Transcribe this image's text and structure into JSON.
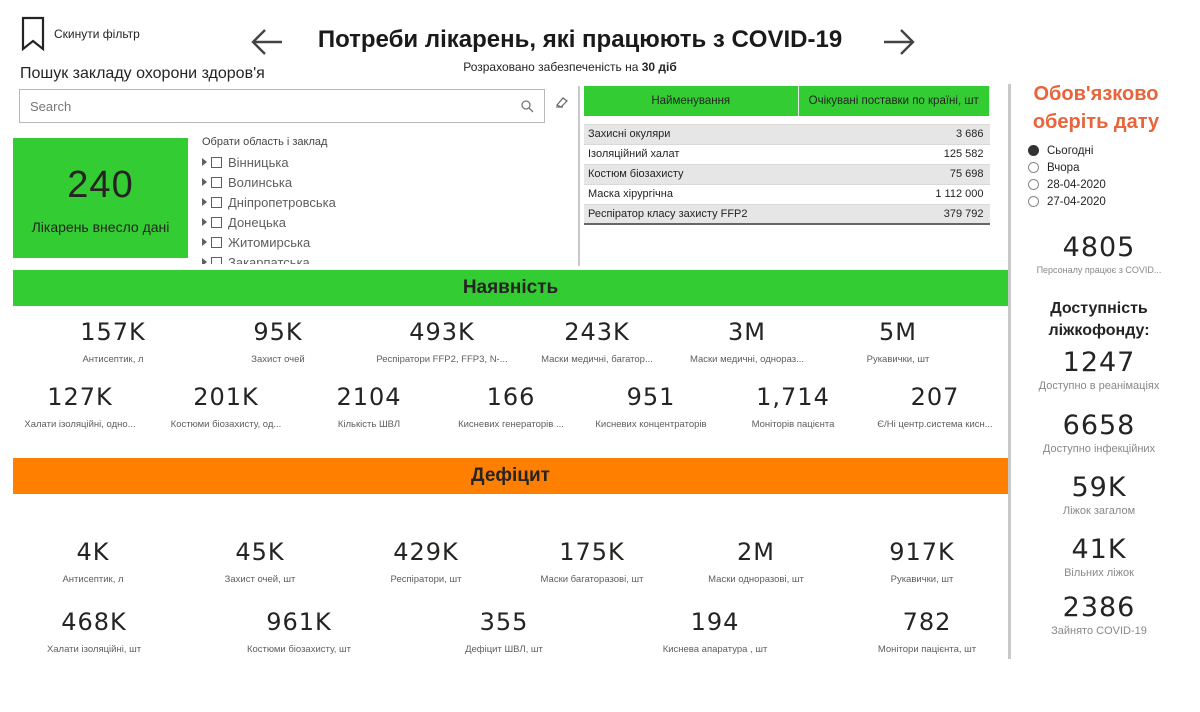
{
  "header": {
    "reset_filter": "Скинути фільтр",
    "title": "Потреби лікарень, які працюють з COVID-19",
    "subtitle_prefix": "Розраховано забезпеченість на",
    "subtitle_days": "30 діб"
  },
  "search": {
    "label": "Пошук закладу охорони здоров'я",
    "placeholder": "Search"
  },
  "hospitals_card": {
    "value": "240",
    "label": "Лікарень внесло дані"
  },
  "region_slicer": {
    "header": "Обрати область і заклад",
    "items": [
      "Вінницька",
      "Волинська",
      "Дніпропетровська",
      "Донецька",
      "Житомирська",
      "Закарпатська"
    ]
  },
  "supply_table": {
    "columns": [
      "Найменування",
      "Очікувані поставки по країні, шт"
    ],
    "rows": [
      [
        "Захисні окуляри",
        "3 686"
      ],
      [
        "Ізоляційний халат",
        "125 582"
      ],
      [
        "Костюм біозахисту",
        "75 698"
      ],
      [
        "Маска хірургічна",
        "1 112 000"
      ],
      [
        "Респіратор класу захисту FFP2",
        "379 792"
      ]
    ]
  },
  "availability": {
    "title": "Наявність",
    "row1": [
      {
        "value": "157K",
        "label": "Антисептик, л"
      },
      {
        "value": "95K",
        "label": "Захист очей"
      },
      {
        "value": "493K",
        "label": "Респіратори FFP2, FFP3, N-..."
      },
      {
        "value": "243K",
        "label": "Маски медичні, багатор..."
      },
      {
        "value": "3M",
        "label": "Маски медичні, однораз..."
      },
      {
        "value": "5M",
        "label": "Рукавички, шт"
      }
    ],
    "row2": [
      {
        "value": "127K",
        "label": "Халати ізоляційні, одно..."
      },
      {
        "value": "201K",
        "label": "Костюми біозахисту, од..."
      },
      {
        "value": "2104",
        "label": "Кількість ШВЛ"
      },
      {
        "value": "166",
        "label": "Кисневих генераторів ..."
      },
      {
        "value": "951",
        "label": "Кисневих концентраторів"
      },
      {
        "value": "1,714",
        "label": "Моніторів пацієнта"
      },
      {
        "value": "207",
        "label": "Є/Ні центр.система кисн..."
      }
    ]
  },
  "deficit": {
    "title": "Дефіцит",
    "row1": [
      {
        "value": "4K",
        "label": "Антисептик, л"
      },
      {
        "value": "45K",
        "label": "Захист очей, шт"
      },
      {
        "value": "429K",
        "label": "Респіратори, шт"
      },
      {
        "value": "175K",
        "label": "Маски багаторазові, шт"
      },
      {
        "value": "2M",
        "label": "Маски одноразові, шт"
      },
      {
        "value": "917K",
        "label": "Рукавички, шт"
      }
    ],
    "row2": [
      {
        "value": "468K",
        "label": "Халати ізоляційні, шт"
      },
      {
        "value": "961K",
        "label": "Костюми біозахисту, шт"
      },
      {
        "value": "355",
        "label": "Дефіцит ШВЛ, шт"
      },
      {
        "value": "194",
        "label": "Киснева апаратура , шт"
      },
      {
        "value": "782",
        "label": "Монітори пацієнта, шт"
      }
    ]
  },
  "date_panel": {
    "title": "Обов'язково оберіть дату",
    "options": [
      "Сьогодні",
      "Вчора",
      "28-04-2020",
      "27-04-2020"
    ],
    "selected": "Сьогодні"
  },
  "staff": {
    "value": "4805",
    "label": "Персоналу працює з COVID..."
  },
  "beds": {
    "title": "Доступність ліжкофонду:",
    "items": [
      {
        "value": "1247",
        "label": "Доступно в реанімаціях"
      },
      {
        "value": "6658",
        "label": "Доступно інфекційних"
      },
      {
        "value": "59K",
        "label": "Ліжок загалом"
      },
      {
        "value": "41K",
        "label": "Вільних ліжок"
      },
      {
        "value": "2386",
        "label": "Зайнято COVID-19"
      }
    ]
  },
  "colors": {
    "green": "#33cc33",
    "orange": "#ff8000",
    "accent_text": "#e8643a"
  }
}
